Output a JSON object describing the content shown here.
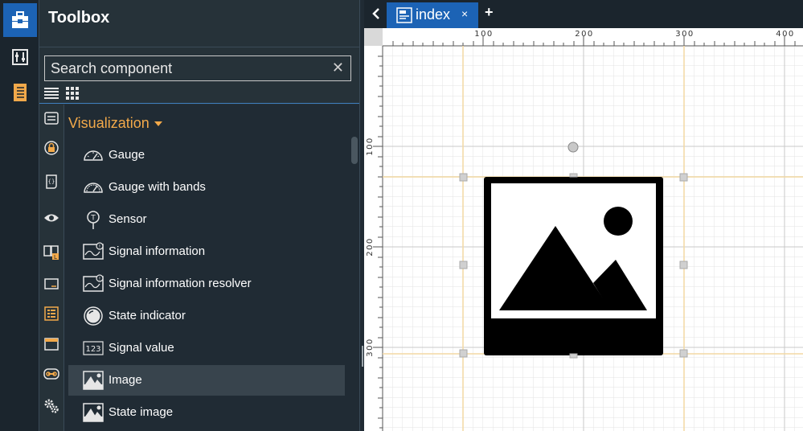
{
  "rail": {
    "items": [
      {
        "icon": "toolbox-icon",
        "active": true
      },
      {
        "icon": "sliders-icon",
        "active": false
      },
      {
        "icon": "notebook-icon",
        "active": false
      }
    ]
  },
  "toolbox": {
    "title": "Toolbox",
    "search": {
      "placeholder": "Search component",
      "value": ""
    },
    "view_modes": [
      "list-view-icon",
      "grid-view-icon"
    ]
  },
  "category_icons": [
    "list-icon",
    "lock-badge-icon",
    "script-icon",
    "eye-icon",
    "book-badge-icon",
    "panel-icon",
    "checklist-icon",
    "window-icon",
    "link-icon",
    "gears-icon"
  ],
  "category": {
    "name": "Visualization"
  },
  "components": [
    {
      "label": "Gauge",
      "icon": "gauge-icon"
    },
    {
      "label": "Gauge with bands",
      "icon": "gauge-bands-icon"
    },
    {
      "label": "Sensor",
      "icon": "sensor-icon"
    },
    {
      "label": "Signal information",
      "icon": "signal-info-icon"
    },
    {
      "label": "Signal information resolver",
      "icon": "signal-resolver-icon"
    },
    {
      "label": "State indicator",
      "icon": "state-indicator-icon"
    },
    {
      "label": "Signal value",
      "icon": "signal-value-icon"
    },
    {
      "label": "Image",
      "icon": "image-icon",
      "selected": true
    },
    {
      "label": "State image",
      "icon": "state-image-icon"
    }
  ],
  "tabs": [
    {
      "label": "index",
      "active": true
    }
  ],
  "tab_controls": {
    "back": "chevron-left-icon",
    "close": "×",
    "add": "+"
  },
  "ruler": {
    "top": [
      "100",
      "200",
      "300",
      "400"
    ],
    "left": [
      "100",
      "200",
      "300"
    ]
  },
  "colors": {
    "accent": "#1c63b5",
    "category": "#f2a94a",
    "guide": "#f3d9a3"
  }
}
